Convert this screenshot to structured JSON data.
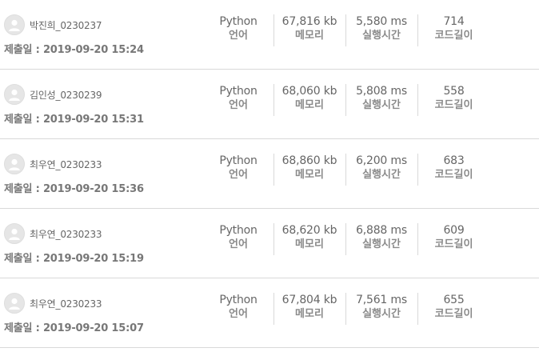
{
  "labels": {
    "date_prefix": "제출일 : ",
    "language": "언어",
    "memory": "메모리",
    "time": "실행시간",
    "code_length": "코드길이"
  },
  "submissions": [
    {
      "username": "박진희_0230237",
      "date": "2019-09-20 15:24",
      "language": "Python",
      "memory": "67,816 kb",
      "time": "5,580 ms",
      "code_length": "714"
    },
    {
      "username": "김인성_0230239",
      "date": "2019-09-20 15:31",
      "language": "Python",
      "memory": "68,060 kb",
      "time": "5,808 ms",
      "code_length": "558"
    },
    {
      "username": "최우연_0230233",
      "date": "2019-09-20 15:36",
      "language": "Python",
      "memory": "68,860 kb",
      "time": "6,200 ms",
      "code_length": "683"
    },
    {
      "username": "최우연_0230233",
      "date": "2019-09-20 15:19",
      "language": "Python",
      "memory": "68,620 kb",
      "time": "6,888 ms",
      "code_length": "609"
    },
    {
      "username": "최우연_0230233",
      "date": "2019-09-20 15:07",
      "language": "Python",
      "memory": "67,804 kb",
      "time": "7,561 ms",
      "code_length": "655"
    }
  ]
}
